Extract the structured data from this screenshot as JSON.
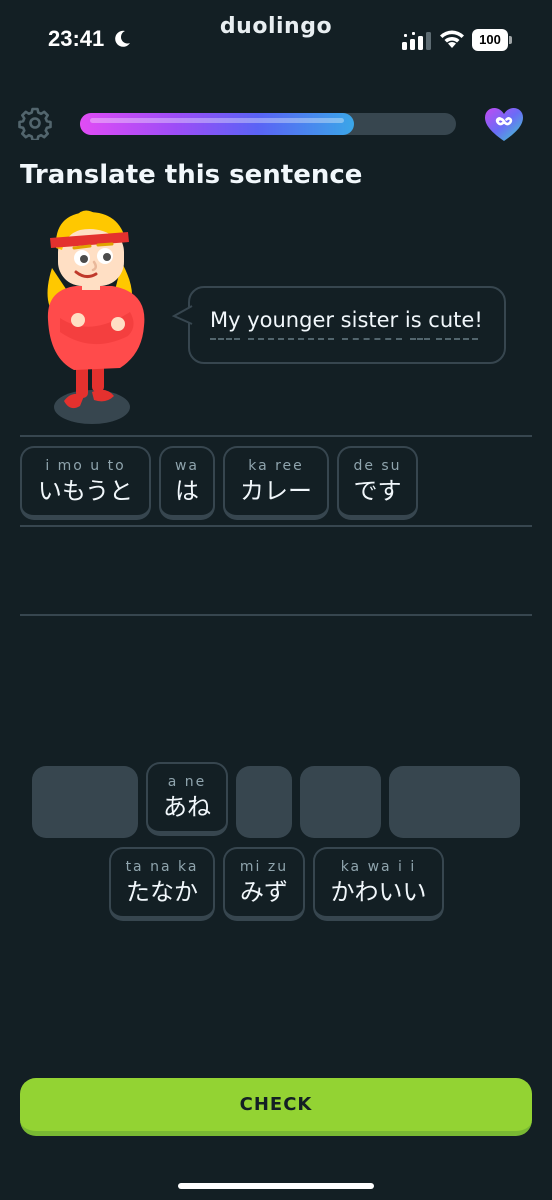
{
  "status_bar": {
    "time": "23:41",
    "battery": "100",
    "icons": [
      "moon-icon",
      "signal-icon",
      "wifi-icon",
      "battery-icon"
    ]
  },
  "app": {
    "brand": "duolingo"
  },
  "header": {
    "progress": 0.73,
    "icons": [
      "gear-icon",
      "infinity-heart-icon"
    ]
  },
  "prompt": {
    "title": "Translate this sentence",
    "sentence": "My younger sister is cute!"
  },
  "answer_tiles": [
    {
      "romaji": "i mo u to",
      "kana": "いもうと"
    },
    {
      "romaji": "wa",
      "kana": "は"
    },
    {
      "romaji": "ka ree",
      "kana": "カレー"
    },
    {
      "romaji": "de su",
      "kana": "です"
    }
  ],
  "word_bank_row1": [
    {
      "romaji": "a ne",
      "kana": "あね"
    }
  ],
  "word_bank_row2": [
    {
      "romaji": "ta na ka",
      "kana": "たなか"
    },
    {
      "romaji": "mi zu",
      "kana": "みず"
    },
    {
      "romaji": "ka wa i i",
      "kana": "かわいい"
    }
  ],
  "check_button": {
    "label": "CHECK"
  },
  "colors": {
    "background": "#131f24",
    "border": "#37464f",
    "accent_green": "#93d333",
    "progress_start": "#e14cf5",
    "progress_end": "#3aa6e8"
  }
}
